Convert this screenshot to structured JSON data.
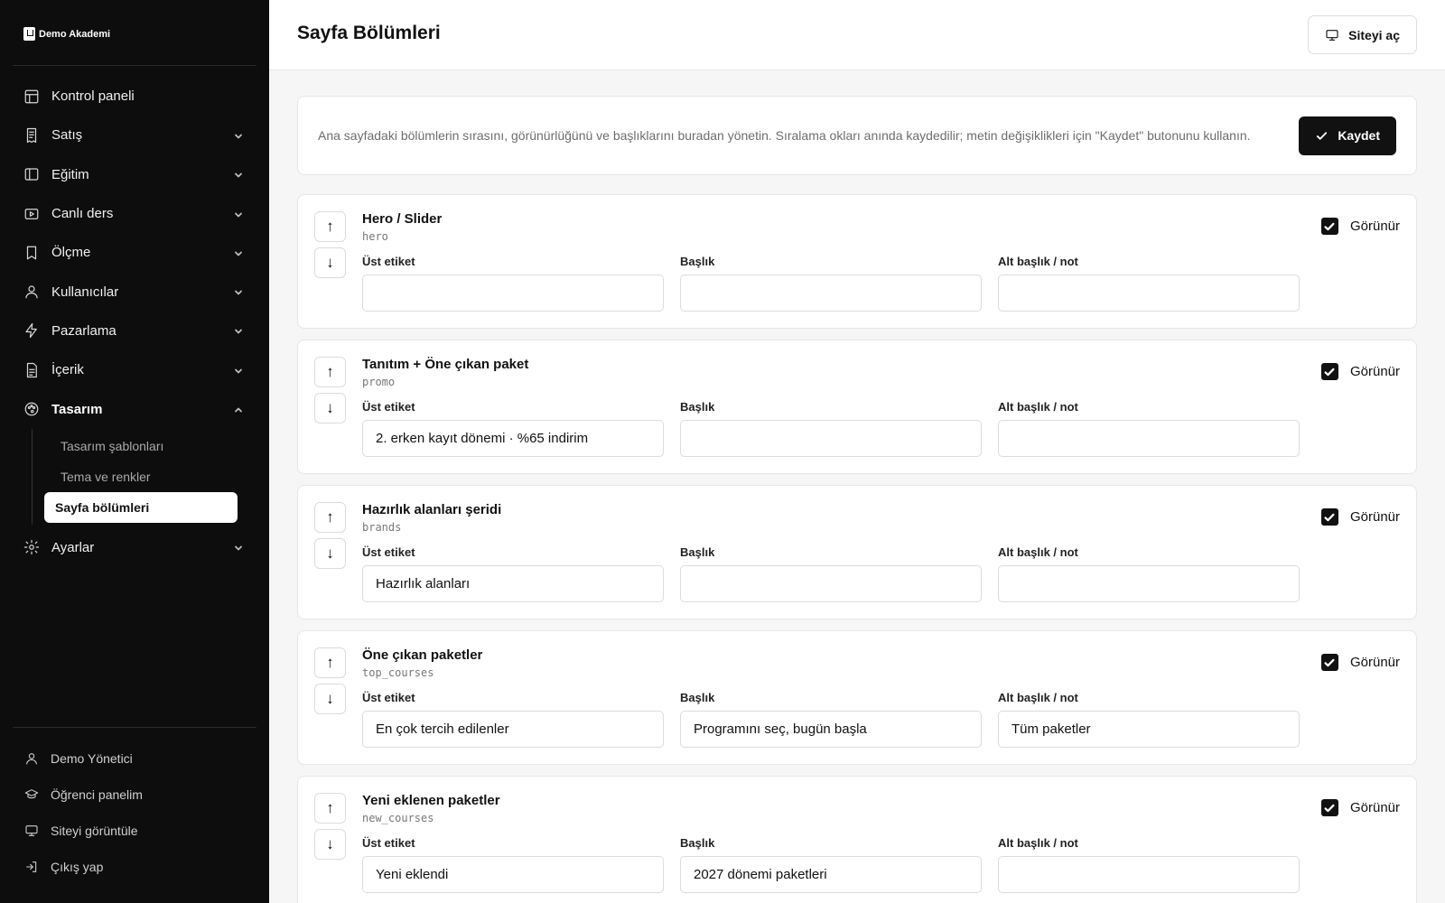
{
  "app": {
    "name": "Demo Akademi"
  },
  "header": {
    "title": "Sayfa Bölümleri",
    "open_site_label": "Siteyi aç"
  },
  "sidebar": {
    "items": [
      {
        "label": "Kontrol paneli",
        "icon": "layout-icon",
        "has_chevron": false
      },
      {
        "label": "Satış",
        "icon": "receipt-icon",
        "has_chevron": true
      },
      {
        "label": "Eğitim",
        "icon": "book-open-icon",
        "has_chevron": true
      },
      {
        "label": "Canlı ders",
        "icon": "video-icon",
        "has_chevron": true
      },
      {
        "label": "Ölçme",
        "icon": "bookmark-icon",
        "has_chevron": true
      },
      {
        "label": "Kullanıcılar",
        "icon": "user-icon",
        "has_chevron": true
      },
      {
        "label": "Pazarlama",
        "icon": "zap-icon",
        "has_chevron": true
      },
      {
        "label": "İçerik",
        "icon": "file-icon",
        "has_chevron": true
      },
      {
        "label": "Tasarım",
        "icon": "palette-icon",
        "has_chevron": true,
        "expanded": true
      },
      {
        "label": "Ayarlar",
        "icon": "gear-icon",
        "has_chevron": true
      }
    ],
    "design_sub": [
      {
        "label": "Tasarım şablonları",
        "active": false
      },
      {
        "label": "Tema ve renkler",
        "active": false
      },
      {
        "label": "Sayfa bölümleri",
        "active": true
      }
    ],
    "footer": [
      {
        "label": "Demo Yönetici",
        "icon": "user-icon"
      },
      {
        "label": "Öğrenci panelim",
        "icon": "graduation-cap-icon"
      },
      {
        "label": "Siteyi görüntüle",
        "icon": "monitor-icon"
      },
      {
        "label": "Çıkış yap",
        "icon": "log-out-icon"
      }
    ]
  },
  "info": {
    "text": "Ana sayfadaki bölümlerin sırasını, görünürlüğünü ve başlıklarını buradan yönetin. Sıralama okları anında kaydedilir; metin değişiklikleri için \"Kaydet\" butonunu kullanın.",
    "save_label": "Kaydet"
  },
  "labels": {
    "eyebrow": "Üst etiket",
    "title": "Başlık",
    "subtitle": "Alt başlık / not",
    "visible": "Görünür",
    "up": "↑",
    "down": "↓"
  },
  "sections": [
    {
      "name": "Hero / Slider",
      "key": "hero",
      "eyebrow": "",
      "title": "",
      "subtitle": "",
      "visible": true
    },
    {
      "name": "Tanıtım + Öne çıkan paket",
      "key": "promo",
      "eyebrow": "2. erken kayıt dönemi · %65 indirim",
      "title": "",
      "subtitle": "",
      "visible": true
    },
    {
      "name": "Hazırlık alanları şeridi",
      "key": "brands",
      "eyebrow": "Hazırlık alanları",
      "title": "",
      "subtitle": "",
      "visible": true
    },
    {
      "name": "Öne çıkan paketler",
      "key": "top_courses",
      "eyebrow": "En çok tercih edilenler",
      "title": "Programını seç, bugün başla",
      "subtitle": "Tüm paketler",
      "visible": true
    },
    {
      "name": "Yeni eklenen paketler",
      "key": "new_courses",
      "eyebrow": "Yeni eklendi",
      "title": "2027 dönemi paketleri",
      "subtitle": "",
      "visible": true
    }
  ]
}
